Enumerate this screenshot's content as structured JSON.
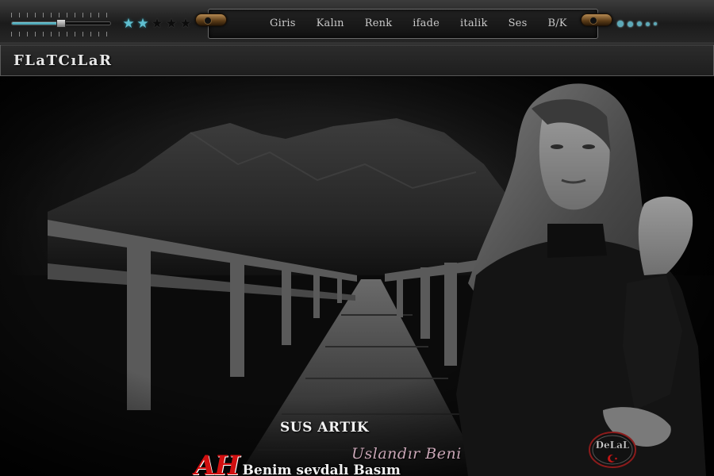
{
  "player": {
    "volume_level": 0.5,
    "rating": {
      "filled": 2,
      "total": 5
    },
    "dots": 5
  },
  "menu": {
    "items": [
      "Giris",
      "Kalın",
      "Renk",
      "ifade",
      "italik",
      "Ses",
      "B/K"
    ]
  },
  "header": {
    "title": "FLaTCıLaR"
  },
  "lyrics": {
    "ah": "AH",
    "line1": "Benim sevdalı Basım",
    "line2": "SUS ARTIK",
    "line3": "Uslandır Beni"
  },
  "logo": {
    "text": "DeLaL",
    "icon": "crescent-star-icon"
  },
  "colors": {
    "accent": "#5fbfd0",
    "ah_red": "#d10f10",
    "brass": "#8a6433"
  }
}
